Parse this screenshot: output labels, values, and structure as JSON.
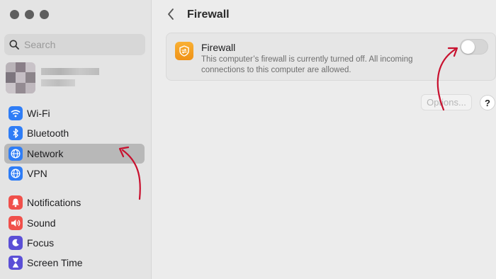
{
  "sidebar": {
    "search_placeholder": "Search",
    "items": [
      {
        "label": "Wi-Fi",
        "icon": "wifi-icon",
        "color": "#2f7df6"
      },
      {
        "label": "Bluetooth",
        "icon": "bluetooth-icon",
        "color": "#2f7df6"
      },
      {
        "label": "Network",
        "icon": "globe-icon",
        "color": "#2f7df6",
        "selected": true
      },
      {
        "label": "VPN",
        "icon": "globe-icon",
        "color": "#2f7df6"
      },
      {
        "label": "Notifications",
        "icon": "bell-icon",
        "color": "#f0504b"
      },
      {
        "label": "Sound",
        "icon": "speaker-icon",
        "color": "#f0504b"
      },
      {
        "label": "Focus",
        "icon": "moon-icon",
        "color": "#5b4fd6"
      },
      {
        "label": "Screen Time",
        "icon": "hourglass-icon",
        "color": "#5b4fd6"
      }
    ]
  },
  "main": {
    "title": "Firewall",
    "card": {
      "title": "Firewall",
      "description": "This computer’s firewall is currently turned off. All incoming connections to this computer are allowed.",
      "toggle_on": false,
      "icon_color": "#f5a122"
    },
    "options_label": "Options...",
    "help_label": "?"
  },
  "colors": {
    "annotation_arrow": "#c8102e"
  }
}
